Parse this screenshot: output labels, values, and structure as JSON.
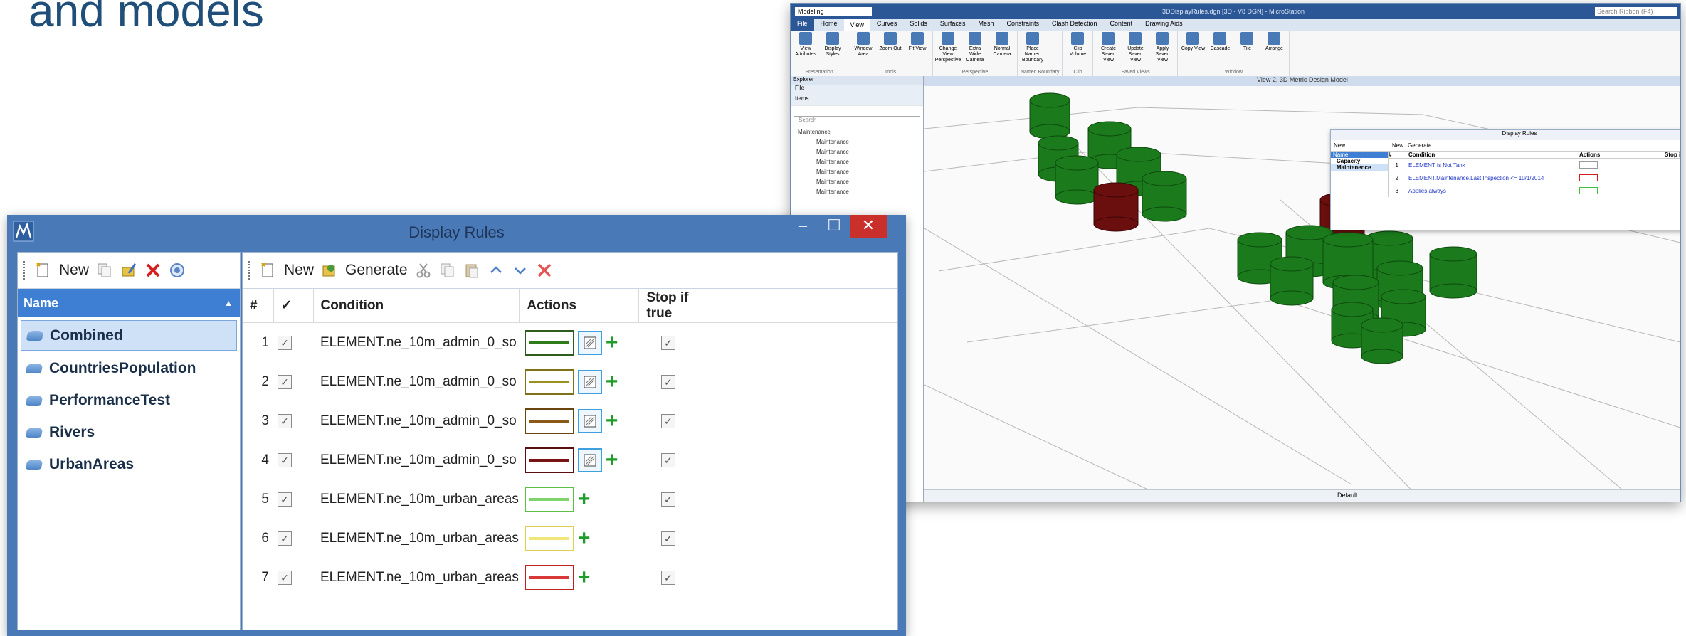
{
  "heading": "and models",
  "back_window": {
    "workflow": "Modeling",
    "title": "3DDisplayRules.dgn [3D - V8 DGN] - MicroStation",
    "search_placeholder": "Search Ribbon (F4)",
    "menu": [
      "File",
      "Home",
      "View",
      "Curves",
      "Solids",
      "Surfaces",
      "Mesh",
      "Constraints",
      "Clash Detection",
      "Content",
      "Drawing Aids"
    ],
    "ribbon_groups": [
      {
        "label": "Presentation",
        "buttons": [
          "View Attributes",
          "Display Styles"
        ]
      },
      {
        "label": "Tools",
        "buttons": [
          "Window Area",
          "Zoom Out",
          "Fit View"
        ]
      },
      {
        "label": "Perspective",
        "buttons": [
          "Change View Perspective",
          "Extra Wide Camera",
          "Normal Camera"
        ]
      },
      {
        "label": "Named Boundary",
        "buttons": [
          "Place Named Boundary"
        ]
      },
      {
        "label": "Clip",
        "buttons": [
          "Clip Volume"
        ]
      },
      {
        "label": "Saved Views",
        "buttons": [
          "Create Saved View",
          "Update Saved View",
          "Apply Saved View"
        ]
      },
      {
        "label": "Window",
        "buttons": [
          "Copy View",
          "Cascade",
          "Tile",
          "Arrange"
        ]
      }
    ],
    "explorer": {
      "title": "Explorer",
      "file": "File",
      "items": "Items",
      "search": "Search",
      "tree_root": "Maintenance",
      "tree_children": [
        "Maintenance",
        "Maintenance",
        "Maintenance",
        "Maintenance",
        "Maintenance",
        "Maintenance"
      ]
    },
    "view_title": "View 2, 3D Metric Design Model",
    "status_default": "Default",
    "small_rules": {
      "title": "Display Rules",
      "new": "New",
      "generate": "Generate",
      "name_header": "Name",
      "sets": [
        "Capacity",
        "Maintenence"
      ],
      "headers": [
        "#",
        "Condition",
        "Actions",
        "Stop if true"
      ],
      "rows": [
        {
          "n": "1",
          "condition": "ELEMENT Is Not Tank",
          "color": "#9a9a9a"
        },
        {
          "n": "2",
          "condition": "ELEMENT.Maintenance.Last Inspection <= 10/1/2014",
          "color": "#d02020"
        },
        {
          "n": "3",
          "condition": "Applies always",
          "color": "#40c040"
        }
      ]
    }
  },
  "dialog": {
    "title": "Display Rules",
    "left_toolbar": {
      "new_label": "New"
    },
    "right_toolbar": {
      "new_label": "New",
      "generate_label": "Generate"
    },
    "name_header": "Name",
    "rule_sets": [
      "Combined",
      "CountriesPopulation",
      "PerformanceTest",
      "Rivers",
      "UrbanAreas"
    ],
    "selected_rule_set": "Combined",
    "columns": {
      "num": "#",
      "check": "✓",
      "condition": "Condition",
      "actions": "Actions",
      "stop": "Stop if true"
    },
    "rules": [
      {
        "n": "1",
        "condition": "ELEMENT.ne_10m_admin_0_so",
        "line_color": "#2e7d1a",
        "border_color": "#2e5c1a",
        "has_pattern": true
      },
      {
        "n": "2",
        "condition": "ELEMENT.ne_10m_admin_0_so",
        "line_color": "#9c8f22",
        "border_color": "#7d7218",
        "has_pattern": true
      },
      {
        "n": "3",
        "condition": "ELEMENT.ne_10m_admin_0_so",
        "line_color": "#8a5a16",
        "border_color": "#6b4410",
        "has_pattern": true
      },
      {
        "n": "4",
        "condition": "ELEMENT.ne_10m_admin_0_so",
        "line_color": "#7a1414",
        "border_color": "#5a0e0e",
        "has_pattern": true
      },
      {
        "n": "5",
        "condition": "ELEMENT.ne_10m_urban_areas",
        "line_color": "#7ed36a",
        "border_color": "#5cc048",
        "has_pattern": false
      },
      {
        "n": "6",
        "condition": "ELEMENT.ne_10m_urban_areas",
        "line_color": "#f0e67a",
        "border_color": "#e0d050",
        "has_pattern": false
      },
      {
        "n": "7",
        "condition": "ELEMENT.ne_10m_urban_areas",
        "line_color": "#d83838",
        "border_color": "#c02020",
        "has_pattern": false
      }
    ]
  }
}
